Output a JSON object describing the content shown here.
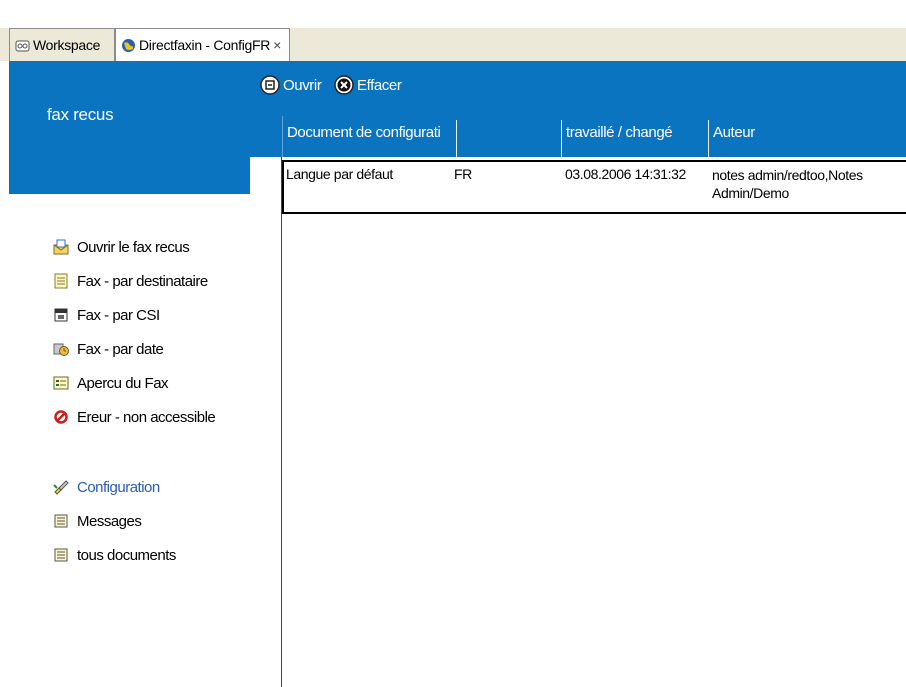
{
  "tabs": [
    {
      "label": "Workspace",
      "icon": "workspace-icon",
      "active": false
    },
    {
      "label": "Directfaxin - ConfigFR",
      "icon": "globe-icon",
      "active": true,
      "close_glyph": "×"
    }
  ],
  "left": {
    "title": "fax recus",
    "nav": [
      {
        "label": "Ouvrir le fax recus",
        "icon": "open-envelope-icon"
      },
      {
        "label": "Fax - par destinataire",
        "icon": "list-icon"
      },
      {
        "label": "Fax - par CSI",
        "icon": "calendar-icon"
      },
      {
        "label": "Fax - par date",
        "icon": "clock-icon"
      },
      {
        "label": "Apercu du Fax",
        "icon": "preview-icon"
      },
      {
        "label": "Ereur - non accessible",
        "icon": "forbidden-icon"
      }
    ],
    "nav2": [
      {
        "label": "Configuration",
        "icon": "configuration-icon",
        "selected": true
      },
      {
        "label": "Messages",
        "icon": "document-icon"
      },
      {
        "label": "tous documents",
        "icon": "document-icon"
      }
    ]
  },
  "toolbar": {
    "open_label": "Ouvrir",
    "delete_label": "Effacer"
  },
  "table": {
    "columns": [
      "Document  de configurati",
      "travaillé / changé",
      "Auteur"
    ],
    "rows": [
      {
        "document": "Langue par défaut",
        "lang": "FR",
        "modified": "03.08.2006 14:31:32",
        "author_line1": "notes admin/redtoo,Notes",
        "author_line2": "Admin/Demo"
      }
    ]
  },
  "colors": {
    "accent_blue": "#0a74c0",
    "selected_link": "#2a5db0"
  }
}
